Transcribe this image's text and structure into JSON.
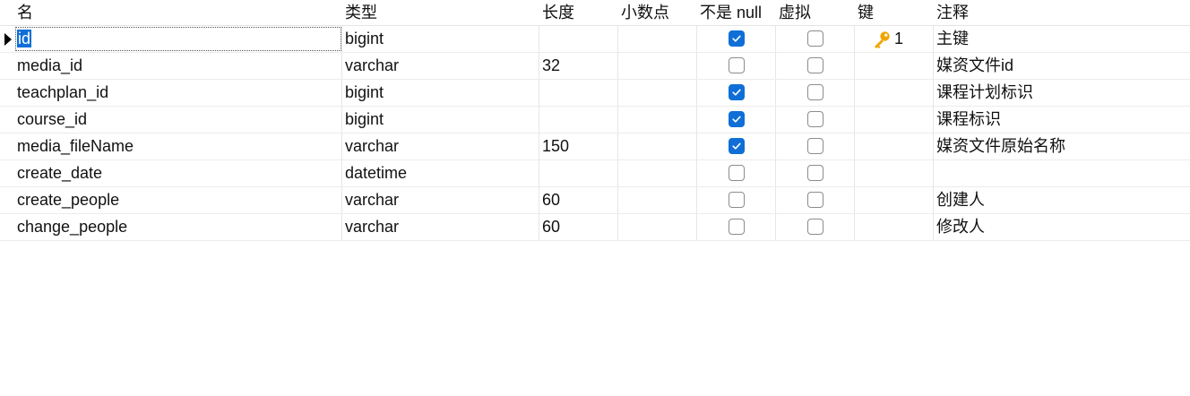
{
  "header": {
    "name": "名",
    "type": "类型",
    "length": "长度",
    "decimals": "小数点",
    "not_null": "不是 null",
    "virtual": "虚拟",
    "key": "键",
    "comment": "注释"
  },
  "colors": {
    "accent": "#0f6fd6",
    "key_icon": "#f0a500"
  },
  "rows": [
    {
      "name": "id",
      "type": "bigint",
      "length": "",
      "decimals": "",
      "not_null": true,
      "virtual": false,
      "key": "1",
      "key_icon": "key-icon",
      "comment": "主键",
      "selected": true
    },
    {
      "name": "media_id",
      "type": "varchar",
      "length": "32",
      "decimals": "",
      "not_null": false,
      "virtual": false,
      "key": "",
      "comment": "媒资文件id"
    },
    {
      "name": "teachplan_id",
      "type": "bigint",
      "length": "",
      "decimals": "",
      "not_null": true,
      "virtual": false,
      "key": "",
      "comment": "课程计划标识"
    },
    {
      "name": "course_id",
      "type": "bigint",
      "length": "",
      "decimals": "",
      "not_null": true,
      "virtual": false,
      "key": "",
      "comment": "课程标识"
    },
    {
      "name": "media_fileName",
      "type": "varchar",
      "length": "150",
      "decimals": "",
      "not_null": true,
      "virtual": false,
      "key": "",
      "comment": "媒资文件原始名称"
    },
    {
      "name": "create_date",
      "type": "datetime",
      "length": "",
      "decimals": "",
      "not_null": false,
      "virtual": false,
      "key": "",
      "comment": ""
    },
    {
      "name": "create_people",
      "type": "varchar",
      "length": "60",
      "decimals": "",
      "not_null": false,
      "virtual": false,
      "key": "",
      "comment": "创建人"
    },
    {
      "name": "change_people",
      "type": "varchar",
      "length": "60",
      "decimals": "",
      "not_null": false,
      "virtual": false,
      "key": "",
      "comment": "修改人"
    }
  ]
}
